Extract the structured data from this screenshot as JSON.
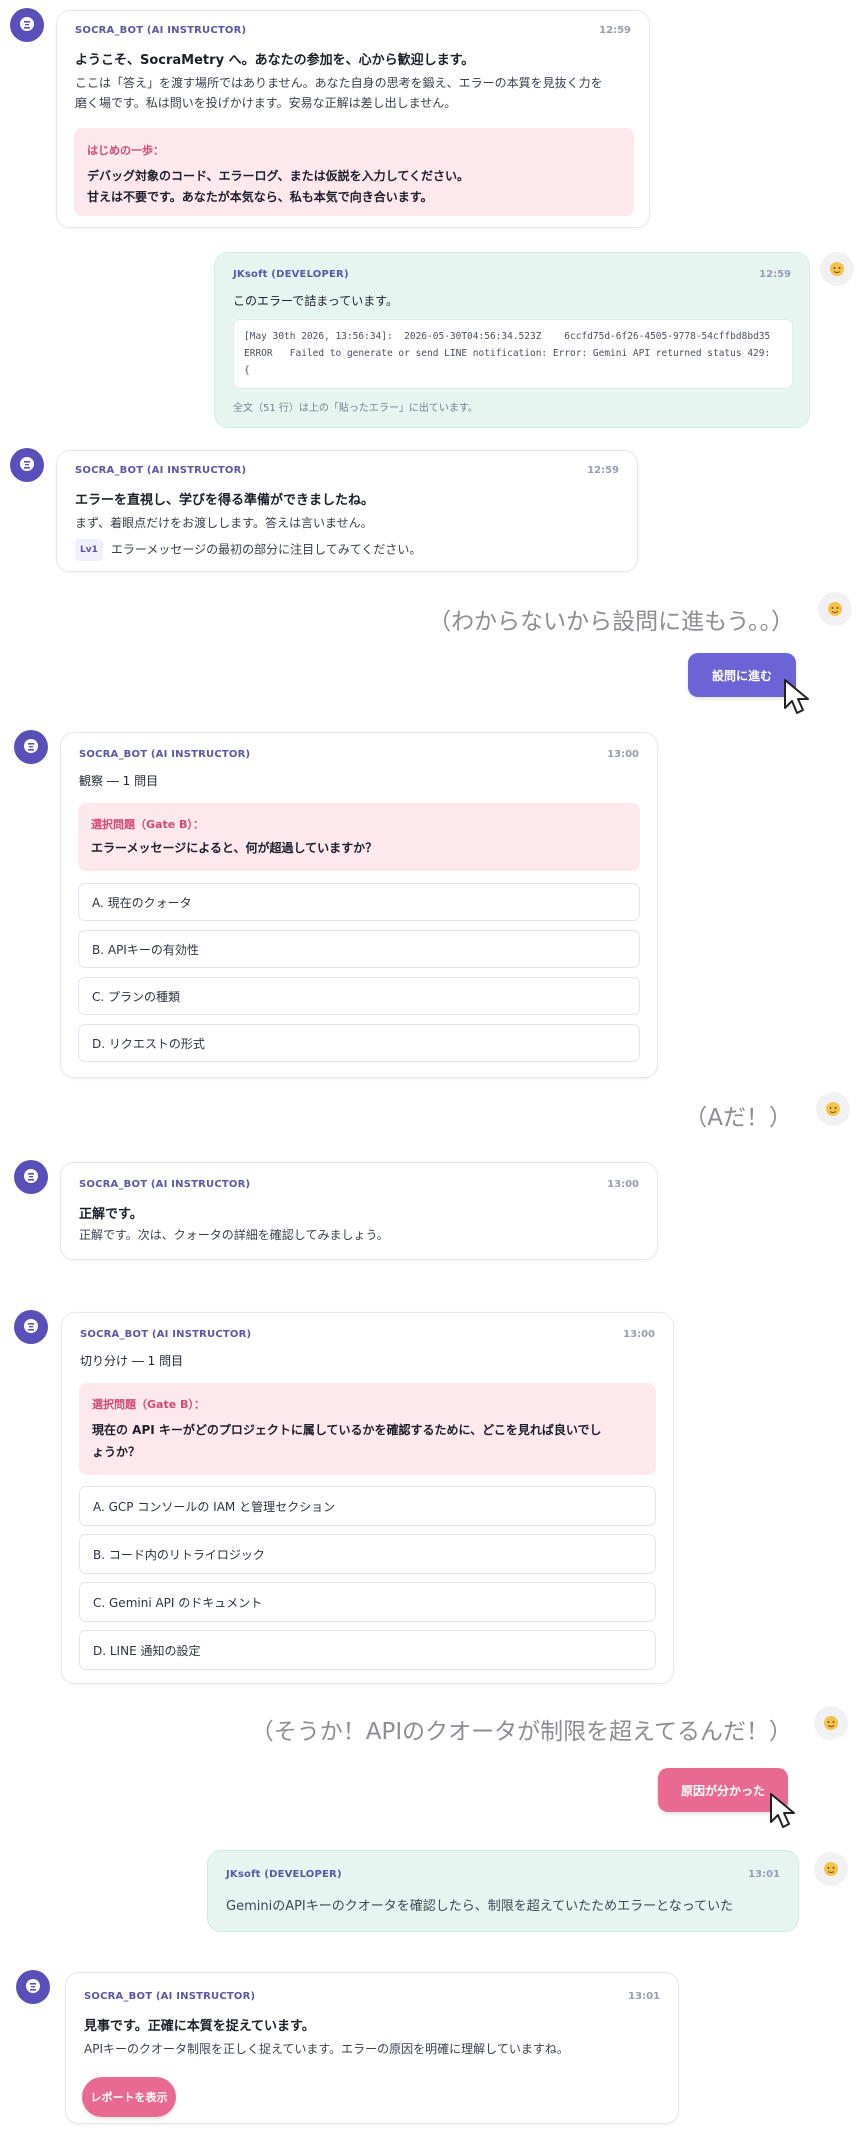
{
  "bot_name": "SOCRA_BOT (AI INSTRUCTOR)",
  "user_name": "JKsoft (DEVELOPER)",
  "colors": {
    "accent": "#6b63d6",
    "bot_avatar": "#5a4fb8",
    "pink_button": "#e86a92",
    "user_bubble": "#e6f5ef",
    "pink_box": "#fde8ee"
  },
  "messages": {
    "m1": {
      "time": "12:59",
      "heading": "ようこそ、SocraMetry へ。あなたの参加を、心から歓迎します。",
      "line1": "ここは「答え」を渡す場所ではありません。あなた自身の思考を鍛え、エラーの本質を見抜く力を",
      "line2": "磨く場です。私は問いを投げかけます。安易な正解は差し出しません。",
      "box_label": "はじめの一歩：",
      "box_line1": "デバッグ対象のコード、エラーログ、または仮説を入力してください。",
      "box_line2": "甘えは不要です。あなたが本気なら、私も本気で向き合います。"
    },
    "m2": {
      "time": "12:59",
      "text": "このエラーで詰まっています。",
      "log_line1": "[May 30th 2026, 13:56:34]:  2026-05-30T04:56:34.523Z    6ccfd75d-6f26-4505-9778-54cffbd8bd35",
      "log_line2": "ERROR   Failed to generate or send LINE notification: Error: Gemini API returned status 429:",
      "log_line3": "{",
      "note": "全文（51 行）は上の「貼ったエラー」に出ています。"
    },
    "m3": {
      "time": "12:59",
      "heading": "エラーを直視し、学びを得る準備ができましたね。",
      "line1": "まず、着眼点だけをお渡しします。答えは言いません。",
      "level": "Lv1",
      "hint": "エラーメッセージの最初の部分に注目してみてください。"
    },
    "thought1": "（わからないから設問に進もう。。）",
    "next_button": "設問に進む",
    "m4": {
      "time": "13:00",
      "subtitle": "観察 ― 1 問目",
      "box_label": "選択問題（Gate B）：",
      "question": "エラーメッセージによると、何が超過していますか？",
      "options": [
        "A. 現在のクォータ",
        "B. APIキーの有効性",
        "C. プランの種類",
        "D. リクエストの形式"
      ]
    },
    "thought2": "（Aだ！）",
    "m5": {
      "time": "13:00",
      "heading": "正解です。",
      "line1": "正解です。次は、クォータの詳細を確認してみましょう。"
    },
    "m6": {
      "time": "13:00",
      "subtitle": "切り分け ― 1 問目",
      "box_label": "選択問題（Gate B）：",
      "question_line1": "現在の API キーがどのプロジェクトに属しているかを確認するために、どこを見れば良いでし",
      "question_line2": "ょうか？",
      "options": [
        "A. GCP コンソールの IAM と管理セクション",
        "B. コード内のリトライロジック",
        "C. Gemini API のドキュメント",
        "D. LINE 通知の設定"
      ]
    },
    "thought3": "（そうか！APIのクオータが制限を超えてるんだ！）",
    "cause_button": "原因が分かった",
    "m7": {
      "time": "13:01",
      "text": "GeminiのAPIキーのクオータを確認したら、制限を超えていたためエラーとなっていた"
    },
    "m8": {
      "time": "13:01",
      "heading": "見事です。正確に本質を捉えています。",
      "line1": "APIキーのクオータ制限を正しく捉えています。エラーの原因を明確に理解していますね。",
      "report_button": "レポートを表示"
    }
  }
}
